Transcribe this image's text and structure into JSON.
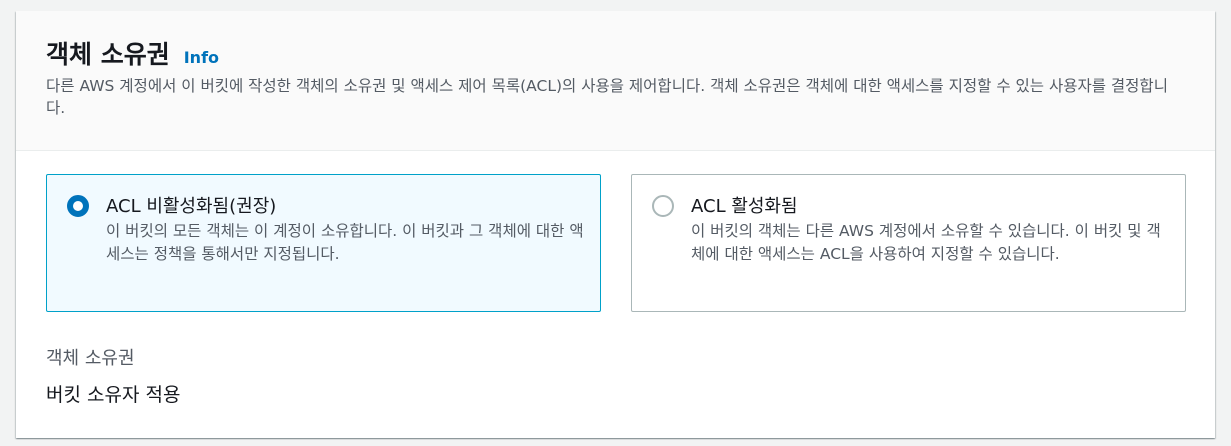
{
  "section": {
    "title": "객체 소유권",
    "info_link": "Info",
    "description": "다른 AWS 계정에서 이 버킷에 작성한 객체의 소유권 및 액세스 제어 목록(ACL)의 사용을 제어합니다. 객체 소유권은 객체에 대한 액세스를 지정할 수 있는 사용자를 결정합니다."
  },
  "options": [
    {
      "label": "ACL 비활성화됨(권장)",
      "description": "이 버킷의 모든 객체는 이 계정이 소유합니다. 이 버킷과 그 객체에 대한 액세스는 정책을 통해서만 지정됩니다.",
      "selected": true
    },
    {
      "label": "ACL 활성화됨",
      "description": "이 버킷의 객체는 다른 AWS 계정에서 소유할 수 있습니다. 이 버킷 및 객체에 대한 액세스는 ACL을 사용하여 지정할 수 있습니다.",
      "selected": false
    }
  ],
  "ownership": {
    "label": "객체 소유권",
    "value": "버킷 소유자 적용"
  },
  "colors": {
    "accent": "#0073bb",
    "selected_border": "#00a1c9",
    "selected_bg": "#f1faff"
  }
}
